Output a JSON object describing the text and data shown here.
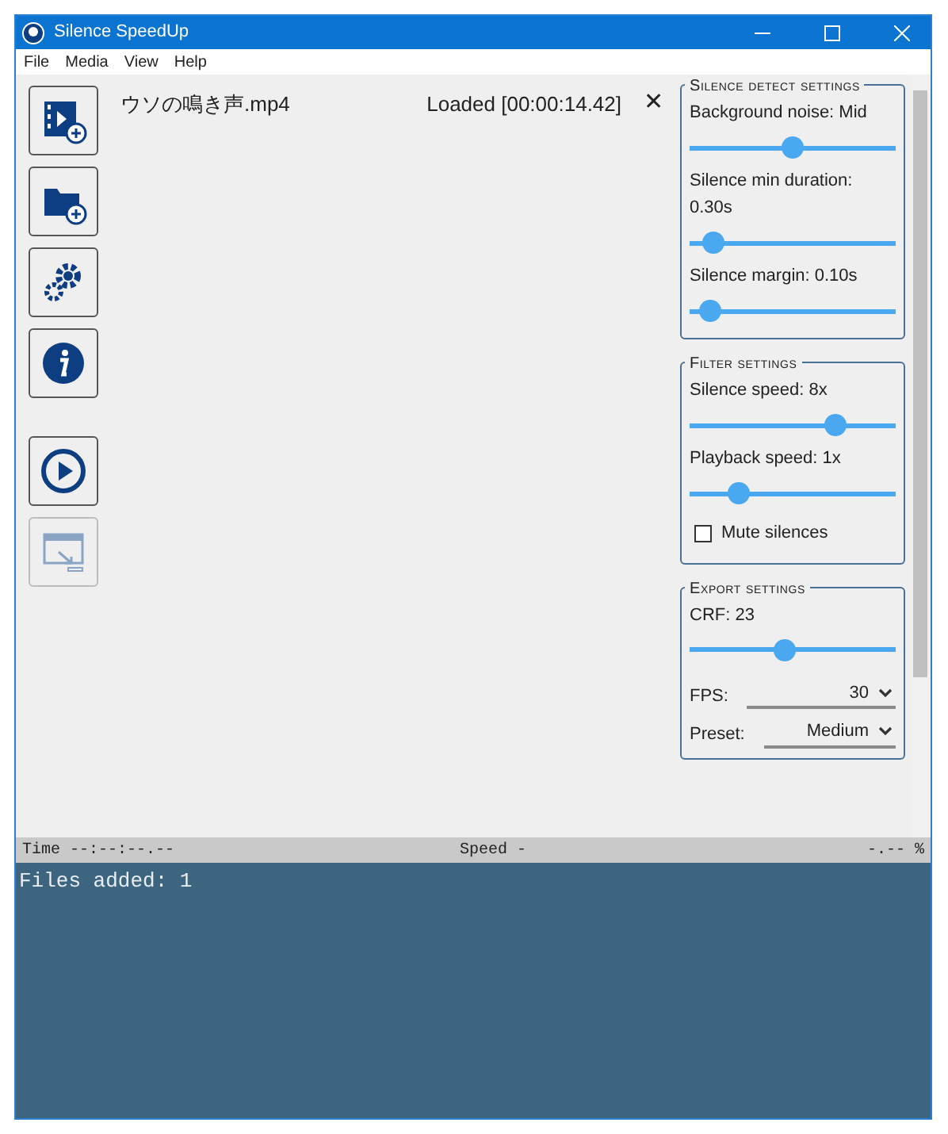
{
  "window": {
    "title": "Silence SpeedUp"
  },
  "menu": [
    "File",
    "Media",
    "View",
    "Help"
  ],
  "toolbar": [
    {
      "kind": "add-video",
      "disabled": false
    },
    {
      "kind": "add-folder",
      "disabled": false
    },
    {
      "kind": "settings",
      "disabled": false
    },
    {
      "kind": "info",
      "disabled": false
    },
    {
      "kind": "play",
      "disabled": false
    },
    {
      "kind": "export",
      "disabled": true
    }
  ],
  "files": [
    {
      "name": "ウソの鳴き声.mp4",
      "status": "Loaded [00:00:14.42]",
      "remove": "✕"
    }
  ],
  "groups": [
    {
      "title": "Silence detect settings",
      "items": [
        {
          "kind": "slider",
          "label": "Background noise: Mid",
          "level": 0.5
        },
        {
          "kind": "slider",
          "label": "Silence min duration: 0.30s",
          "level": 0.07
        },
        {
          "kind": "slider",
          "label": "Silence margin: 0.10s",
          "level": 0.05
        }
      ]
    },
    {
      "title": "Filter settings",
      "items": [
        {
          "kind": "slider",
          "label": "Silence speed: 8x",
          "level": 0.73
        },
        {
          "kind": "slider",
          "label": "Playback speed: 1x",
          "level": 0.21
        },
        {
          "kind": "checkbox",
          "label": "Mute silences",
          "checked": false
        }
      ]
    },
    {
      "title": "Export settings",
      "items": [
        {
          "kind": "slider",
          "label": "CRF: 23",
          "level": 0.46
        },
        {
          "kind": "select",
          "label": "FPS:",
          "value": "30"
        },
        {
          "kind": "select",
          "label": "Preset:",
          "value": "Medium"
        }
      ]
    }
  ],
  "status_bar": {
    "time_label": "Time",
    "time": "--:--:--.--",
    "speed_label": "Speed",
    "speed": "-",
    "percent": "-.-- %"
  },
  "log": [
    "Files added: 1"
  ]
}
